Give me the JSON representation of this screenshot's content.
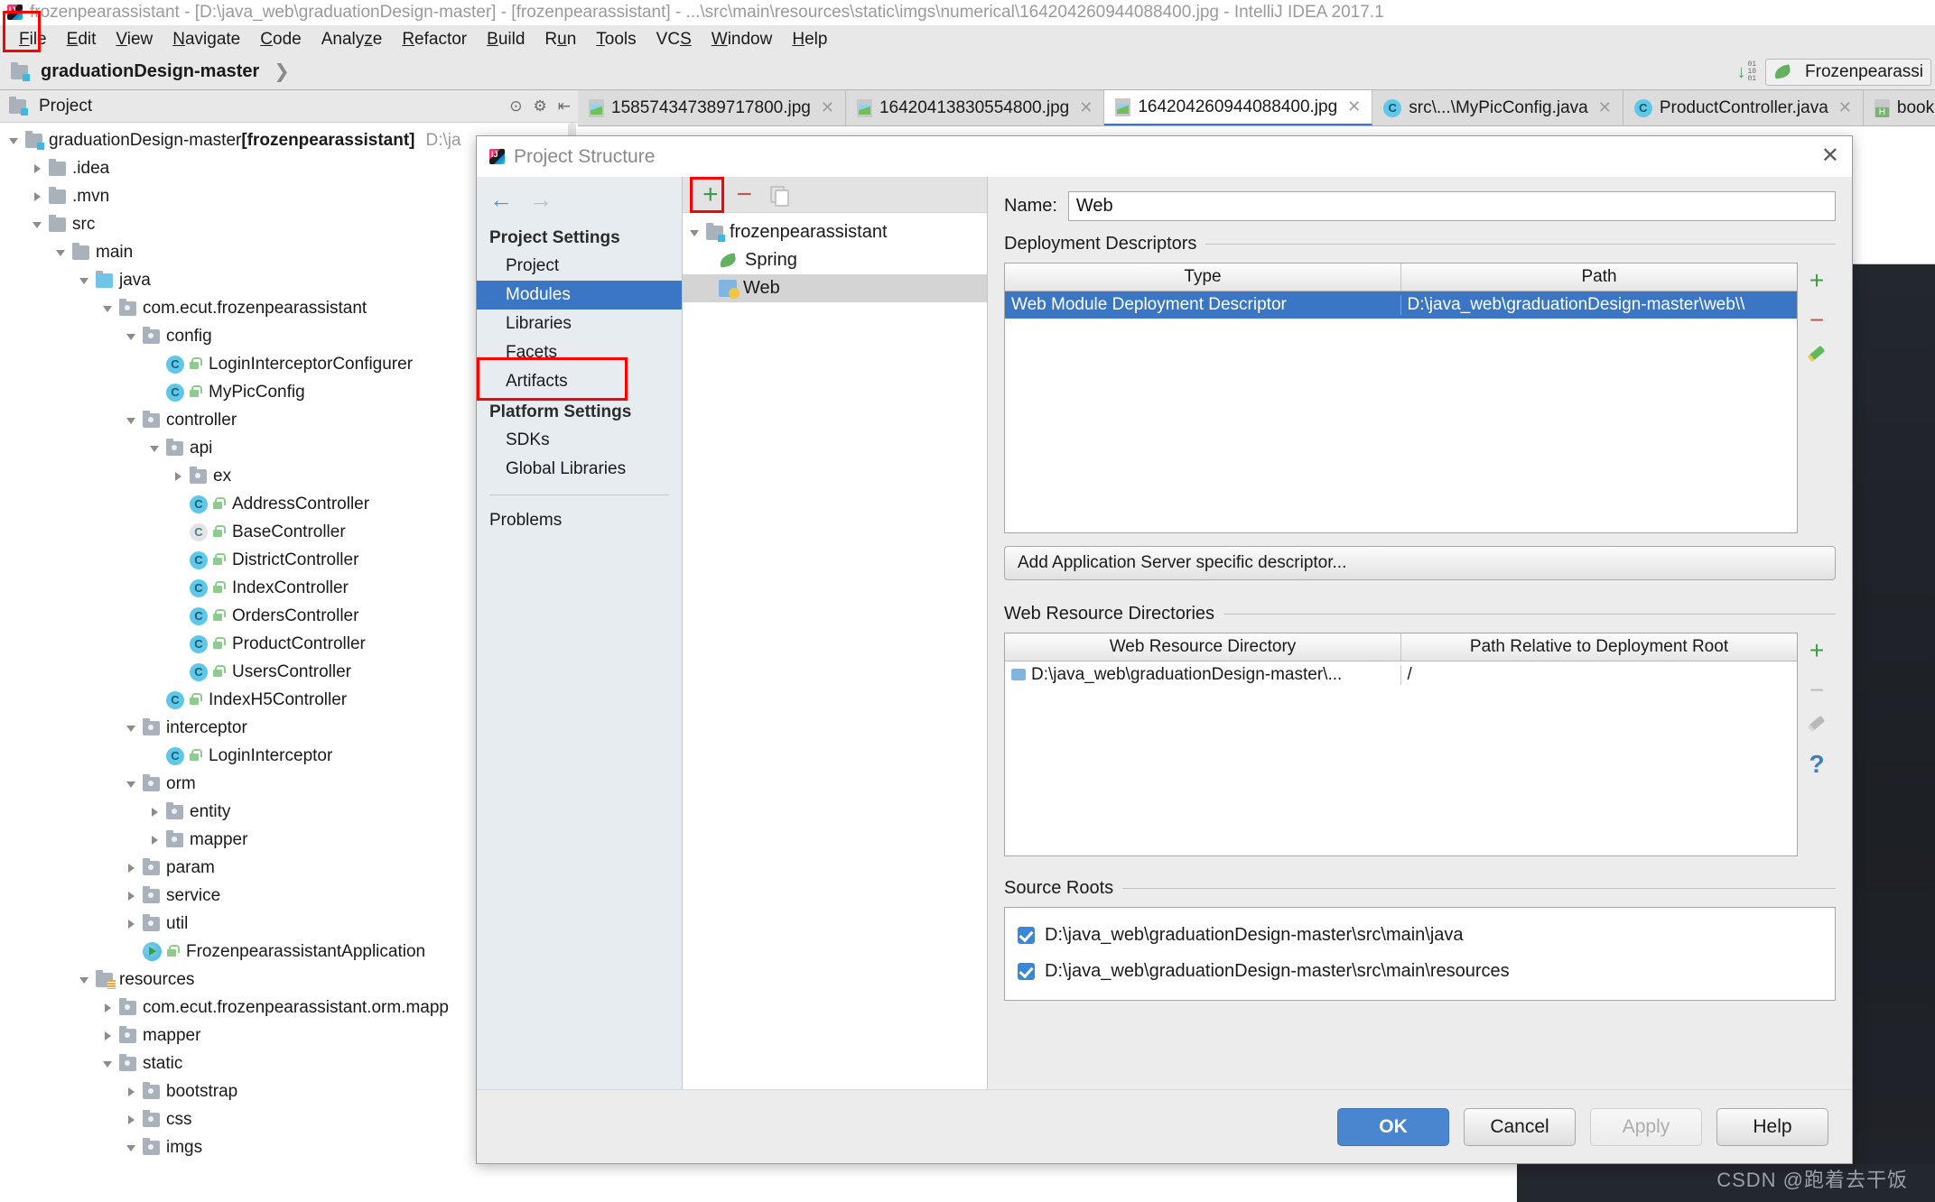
{
  "window": {
    "title": "frozenpearassistant - [D:\\java_web\\graduationDesign-master] - [frozenpearassistant] - ...\\src\\main\\resources\\static\\imgs\\numerical\\164204260944088400.jpg - IntelliJ IDEA 2017.1",
    "logo_icon": "intellij-idea-logo-icon"
  },
  "menubar": {
    "items": [
      {
        "label": "File"
      },
      {
        "label": "Edit"
      },
      {
        "label": "View"
      },
      {
        "label": "Navigate"
      },
      {
        "label": "Code"
      },
      {
        "label": "Analyze"
      },
      {
        "label": "Refactor"
      },
      {
        "label": "Build"
      },
      {
        "label": "Run"
      },
      {
        "label": "Tools"
      },
      {
        "label": "VCS"
      },
      {
        "label": "Window"
      },
      {
        "label": "Help"
      }
    ]
  },
  "navbar": {
    "project_crumb": "graduationDesign-master",
    "run_config": "Frozenpearassi",
    "download_icon": "download-bits-icon",
    "project_icon": "project-folder-icon"
  },
  "project_panel": {
    "header_label": "Project",
    "header_icons": [
      "collapse-all-icon",
      "settings-gear-icon",
      "hide-icon"
    ],
    "tree": [
      {
        "depth": 0,
        "twisty": "open",
        "icon": "project-folder",
        "label": "graduationDesign-master",
        "bold_suffix": "[frozenpearassistant]",
        "dim": "D:\\ja"
      },
      {
        "depth": 1,
        "twisty": "closed",
        "icon": "folder",
        "label": ".idea"
      },
      {
        "depth": 1,
        "twisty": "closed",
        "icon": "folder",
        "label": ".mvn"
      },
      {
        "depth": 1,
        "twisty": "open",
        "icon": "folder",
        "label": "src"
      },
      {
        "depth": 2,
        "twisty": "open",
        "icon": "folder",
        "label": "main"
      },
      {
        "depth": 3,
        "twisty": "open",
        "icon": "source-folder",
        "label": "java"
      },
      {
        "depth": 4,
        "twisty": "open",
        "icon": "package",
        "label": "com.ecut.frozenpearassistant"
      },
      {
        "depth": 5,
        "twisty": "open",
        "icon": "package",
        "label": "config"
      },
      {
        "depth": 6,
        "twisty": "none",
        "icon": "java-class",
        "label": "LoginInterceptorConfigurer"
      },
      {
        "depth": 6,
        "twisty": "none",
        "icon": "java-class",
        "label": "MyPicConfig"
      },
      {
        "depth": 5,
        "twisty": "open",
        "icon": "package",
        "label": "controller"
      },
      {
        "depth": 6,
        "twisty": "open",
        "icon": "package",
        "label": "api"
      },
      {
        "depth": 7,
        "twisty": "closed",
        "icon": "package",
        "label": "ex"
      },
      {
        "depth": 7,
        "twisty": "none",
        "icon": "java-class",
        "label": "AddressController"
      },
      {
        "depth": 7,
        "twisty": "none",
        "icon": "java-class-abstract",
        "label": "BaseController"
      },
      {
        "depth": 7,
        "twisty": "none",
        "icon": "java-class",
        "label": "DistrictController"
      },
      {
        "depth": 7,
        "twisty": "none",
        "icon": "java-class",
        "label": "IndexController"
      },
      {
        "depth": 7,
        "twisty": "none",
        "icon": "java-class",
        "label": "OrdersController"
      },
      {
        "depth": 7,
        "twisty": "none",
        "icon": "java-class",
        "label": "ProductController"
      },
      {
        "depth": 7,
        "twisty": "none",
        "icon": "java-class",
        "label": "UsersController"
      },
      {
        "depth": 6,
        "twisty": "none",
        "icon": "java-class",
        "label": "IndexH5Controller"
      },
      {
        "depth": 5,
        "twisty": "open",
        "icon": "package",
        "label": "interceptor"
      },
      {
        "depth": 6,
        "twisty": "none",
        "icon": "java-class",
        "label": "LoginInterceptor"
      },
      {
        "depth": 5,
        "twisty": "open",
        "icon": "package",
        "label": "orm"
      },
      {
        "depth": 6,
        "twisty": "closed",
        "icon": "package",
        "label": "entity"
      },
      {
        "depth": 6,
        "twisty": "closed",
        "icon": "package",
        "label": "mapper"
      },
      {
        "depth": 5,
        "twisty": "closed",
        "icon": "package",
        "label": "param"
      },
      {
        "depth": 5,
        "twisty": "closed",
        "icon": "package",
        "label": "service"
      },
      {
        "depth": 5,
        "twisty": "closed",
        "icon": "package",
        "label": "util"
      },
      {
        "depth": 5,
        "twisty": "none",
        "icon": "spring-run-class",
        "label": "FrozenpearassistantApplication"
      },
      {
        "depth": 3,
        "twisty": "open",
        "icon": "resources-folder",
        "label": "resources"
      },
      {
        "depth": 4,
        "twisty": "closed",
        "icon": "package",
        "label": "com.ecut.frozenpearassistant.orm.mapp"
      },
      {
        "depth": 4,
        "twisty": "closed",
        "icon": "package",
        "label": "mapper"
      },
      {
        "depth": 4,
        "twisty": "open",
        "icon": "package",
        "label": "static"
      },
      {
        "depth": 5,
        "twisty": "closed",
        "icon": "package",
        "label": "bootstrap"
      },
      {
        "depth": 5,
        "twisty": "closed",
        "icon": "package",
        "label": "css"
      },
      {
        "depth": 5,
        "twisty": "open",
        "icon": "package",
        "label": "imgs"
      }
    ]
  },
  "editor_tabs": [
    {
      "label": "158574347389717800.jpg",
      "icon": "image-file-icon",
      "active": false,
      "closable": true
    },
    {
      "label": "16420413830554800.jpg",
      "icon": "image-file-icon",
      "active": false,
      "closable": true
    },
    {
      "label": "164204260944088400.jpg",
      "icon": "image-file-icon",
      "active": true,
      "closable": true
    },
    {
      "label": "src\\...\\MyPicConfig.java",
      "icon": "java-file-icon",
      "active": false,
      "closable": true
    },
    {
      "label": "ProductController.java",
      "icon": "java-file-icon",
      "active": false,
      "closable": true
    },
    {
      "label": "book.h",
      "icon": "html-file-icon",
      "active": false,
      "closable": false
    }
  ],
  "dialog": {
    "title": "Project Structure",
    "title_icon": "intellij-idea-logo-icon",
    "close_icon": "close-icon",
    "nav": {
      "back_icon": "arrow-back-icon",
      "forward_icon": "arrow-forward-icon",
      "sections": [
        {
          "title": "Project Settings",
          "items": [
            {
              "label": "Project",
              "selected": false
            },
            {
              "label": "Modules",
              "selected": true
            },
            {
              "label": "Libraries",
              "selected": false
            },
            {
              "label": "Facets",
              "selected": false
            },
            {
              "label": "Artifacts",
              "selected": false
            }
          ]
        },
        {
          "title": "Platform Settings",
          "items": [
            {
              "label": "SDKs",
              "selected": false
            },
            {
              "label": "Global Libraries",
              "selected": false
            }
          ]
        }
      ],
      "problems_label": "Problems"
    },
    "module_tree": {
      "toolbar": [
        {
          "icon": "add-plus-icon",
          "highlighted": true
        },
        {
          "icon": "remove-minus-icon",
          "highlighted": false
        },
        {
          "icon": "copy-icon",
          "highlighted": false
        }
      ],
      "nodes": [
        {
          "depth": 0,
          "twisty": "open",
          "icon": "module-folder-icon",
          "label": "frozenpearassistant",
          "selected": false
        },
        {
          "depth": 1,
          "twisty": "none",
          "icon": "spring-leaf-icon",
          "label": "Spring",
          "selected": false
        },
        {
          "depth": 1,
          "twisty": "none",
          "icon": "web-facet-icon",
          "label": "Web",
          "selected": true
        }
      ]
    },
    "right": {
      "name_label": "Name:",
      "name_value": "Web",
      "deployment_descriptors": {
        "group_label": "Deployment Descriptors",
        "columns": [
          "Type",
          "Path"
        ],
        "rows": [
          {
            "type": "Web Module Deployment Descriptor",
            "path": "D:\\java_web\\graduationDesign-master\\web\\\\",
            "selected": true
          }
        ],
        "side_buttons": [
          {
            "icon": "add-plus-icon"
          },
          {
            "icon": "remove-minus-icon"
          },
          {
            "icon": "edit-pencil-icon"
          }
        ]
      },
      "add_descriptor_button": "Add Application Server specific descriptor...",
      "web_resource_directories": {
        "group_label": "Web Resource Directories",
        "columns": [
          "Web Resource Directory",
          "Path Relative to Deployment Root"
        ],
        "rows": [
          {
            "directory": "D:\\java_web\\graduationDesign-master\\...",
            "relative": "/",
            "selected": false
          }
        ],
        "side_buttons": [
          {
            "icon": "add-plus-icon"
          },
          {
            "icon": "remove-minus-icon"
          },
          {
            "icon": "edit-pencil-icon"
          },
          {
            "icon": "help-question-icon"
          }
        ]
      },
      "source_roots": {
        "group_label": "Source Roots",
        "items": [
          {
            "label": "D:\\java_web\\graduationDesign-master\\src\\main\\java",
            "checked": true
          },
          {
            "label": "D:\\java_web\\graduationDesign-master\\src\\main\\resources",
            "checked": true
          }
        ]
      }
    },
    "footer_buttons": [
      {
        "label": "OK",
        "style": "primary"
      },
      {
        "label": "Cancel",
        "style": "normal"
      },
      {
        "label": "Apply",
        "style": "disabled"
      },
      {
        "label": "Help",
        "style": "normal"
      }
    ]
  },
  "watermark": "CSDN @跑着去干饭"
}
